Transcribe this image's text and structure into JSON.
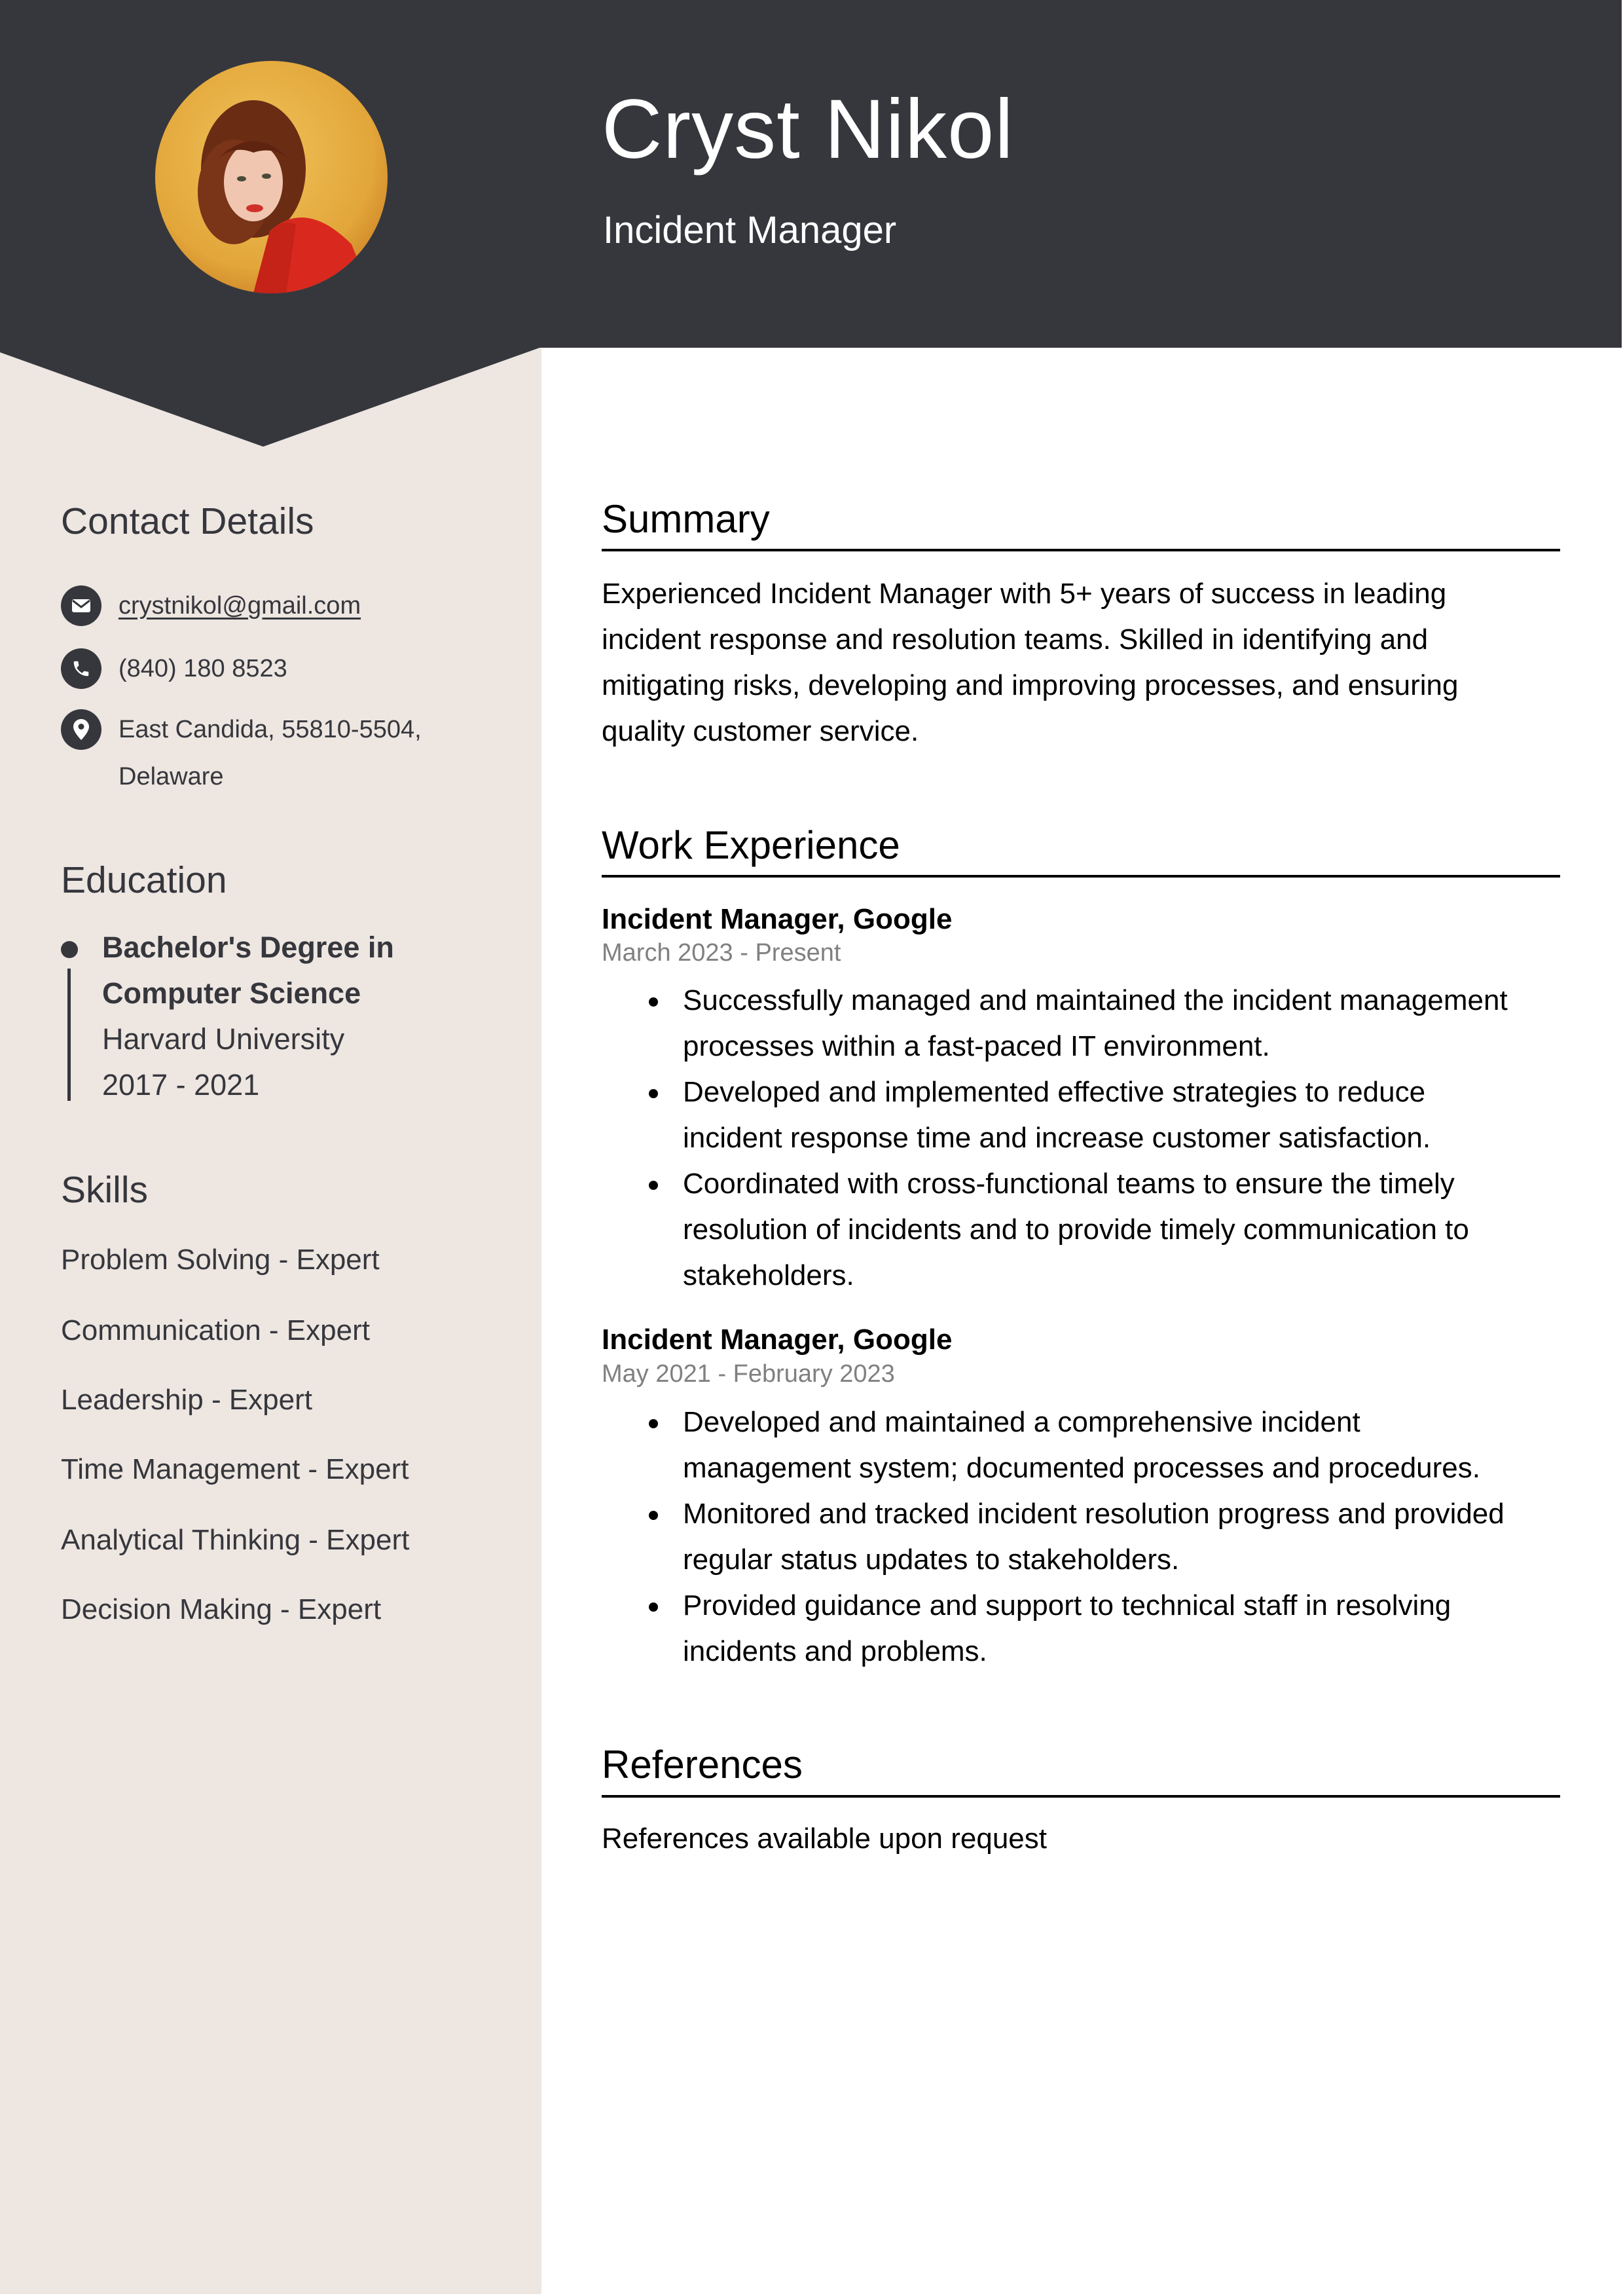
{
  "header": {
    "name": "Cryst Nikol",
    "role": "Incident Manager",
    "photo_alt": "Profile photo of Cryst Nikol"
  },
  "colors": {
    "header_bg": "#36373d",
    "sidebar_bg": "#ede6e1",
    "text_dark": "#36373d",
    "date_gray": "#808080"
  },
  "sidebar": {
    "contact": {
      "heading": "Contact Details",
      "items": [
        {
          "icon": "envelope-icon",
          "text": "crystnikol@gmail.com",
          "is_link": true
        },
        {
          "icon": "phone-icon",
          "text": "(840) 180 8523"
        },
        {
          "icon": "location-pin-icon",
          "line1": "East Candida, 55810-5504,",
          "line2": "Delaware"
        }
      ]
    },
    "education": {
      "heading": "Education",
      "degree_line1": "Bachelor's Degree in",
      "degree_line2": "Computer Science",
      "school": "Harvard University",
      "years": "2017 - 2021"
    },
    "skills": {
      "heading": "Skills",
      "items": [
        "Problem Solving - Expert",
        "Communication - Expert",
        "Leadership - Expert",
        "Time Management - Expert",
        "Analytical Thinking - Expert",
        "Decision Making - Expert"
      ]
    }
  },
  "main": {
    "summary": {
      "heading": "Summary",
      "lines": [
        "Experienced Incident Manager with 5+ years of success in leading",
        "incident response and resolution teams. Skilled in identifying and",
        "mitigating risks, developing and improving processes, and ensuring",
        "quality customer service."
      ]
    },
    "experience": {
      "heading": "Work Experience",
      "jobs": [
        {
          "title": "Incident Manager, Google",
          "dates": "March 2023 - Present",
          "bullets": [
            [
              "Successfully managed and maintained the incident management",
              "processes within a fast-paced IT environment."
            ],
            [
              "Developed and implemented effective strategies to reduce",
              "incident response time and increase customer satisfaction."
            ],
            [
              "Coordinated with cross-functional teams to ensure the timely",
              "resolution of incidents and to provide timely communication to",
              "stakeholders."
            ]
          ]
        },
        {
          "title": "Incident Manager, Google",
          "dates": "May 2021 - February 2023",
          "bullets": [
            [
              "Developed and maintained a comprehensive incident",
              "management system; documented processes and procedures."
            ],
            [
              "Monitored and tracked incident resolution progress and provided",
              "regular status updates to stakeholders."
            ],
            [
              "Provided guidance and support to technical staff in resolving",
              "incidents and problems."
            ]
          ]
        }
      ]
    },
    "references": {
      "heading": "References",
      "text": "References available upon request"
    }
  }
}
